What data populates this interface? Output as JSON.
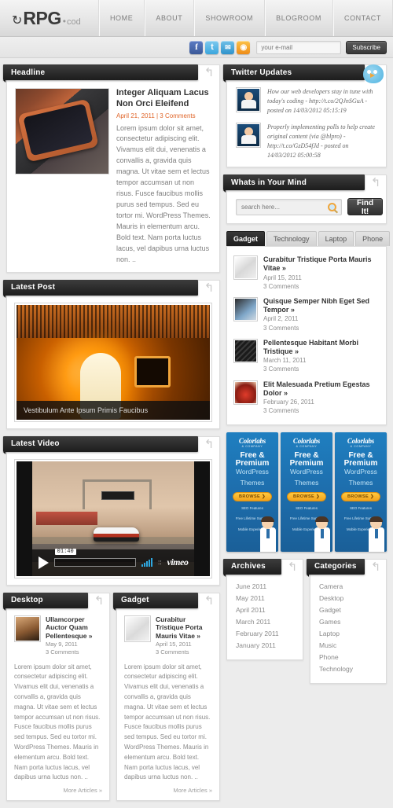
{
  "header": {
    "logo": {
      "arrow_icon": "↻",
      "main": "RPG",
      "dot": "•",
      "sub": "cod"
    },
    "nav": [
      {
        "label": "HOME"
      },
      {
        "label": "ABOUT"
      },
      {
        "label": "SHOWROOM"
      },
      {
        "label": "BLOGROOM"
      },
      {
        "label": "CONTACT"
      }
    ]
  },
  "topbar": {
    "social": [
      {
        "name": "facebook-icon",
        "glyph": "f"
      },
      {
        "name": "twitter-icon",
        "glyph": "t"
      },
      {
        "name": "email-icon",
        "glyph": "✉"
      },
      {
        "name": "rss-icon",
        "glyph": "◉"
      }
    ],
    "email_placeholder": "your e-mail",
    "email_value": "",
    "subscribe_label": "Subscribe"
  },
  "headline": {
    "section_title": "Headline",
    "title": "Integer Aliquam Lacus Non Orci Eleifend",
    "date": "April 21, 2011",
    "comments": "3 Comments",
    "meta": "April 21, 2011 | 3 Comments",
    "body": "Lorem ipsum dolor sit amet, consectetur adipiscing elit. Vivamus elit dui, venenatis a convallis a, gravida quis magna. Ut vitae sem et lectus tempor accumsan ut non risus. Fusce faucibus mollis purus sed tempus. Sed eu tortor mi. WordPress Themes. Mauris in elementum arcu. Bold text. Nam porta luctus lacus, vel dapibus urna luctus non. .."
  },
  "latest_post": {
    "section_title": "Latest Post",
    "caption": "Vestibulum Ante Ipsum Primis Faucibus"
  },
  "latest_video": {
    "section_title": "Latest Video",
    "time": "01:40",
    "provider": "vimeo"
  },
  "twitter": {
    "section_title": "Twitter Updates",
    "items": [
      {
        "text": "How our web developers stay in tune with today's coding - http://t.co/2QJnSGuA - posted on 14/03/2012 05:15:19"
      },
      {
        "text": "Properly implementing polls to help create original content (via @blpro) - http://t.co/GzD54fJd - posted on 14/03/2012 05:00:58"
      }
    ]
  },
  "search": {
    "section_title": "Whats in Your Mind",
    "placeholder": "search here...",
    "value": "",
    "button_label": "Find It!"
  },
  "tabs": {
    "items": [
      {
        "label": "Gadget",
        "active": true
      },
      {
        "label": "Technology",
        "active": false
      },
      {
        "label": "Laptop",
        "active": false
      },
      {
        "label": "Phone",
        "active": false
      }
    ],
    "posts": [
      {
        "title": "Curabitur Tristique Porta Mauris Vitae »",
        "date": "April 15, 2011",
        "comments": "3 Comments"
      },
      {
        "title": "Quisque Semper Nibh Eget Sed Tempor »",
        "date": "April 2, 2011",
        "comments": "3 Comments"
      },
      {
        "title": "Pellentesque Habitant Morbi Tristique »",
        "date": "March 11, 2011",
        "comments": "3 Comments"
      },
      {
        "title": "Elit Malesuada Pretium Egestas Dolor »",
        "date": "February 26, 2011",
        "comments": "3 Comments"
      }
    ]
  },
  "ads": [
    {
      "brand": "Colorlabs",
      "company": "& COMPANY",
      "line1": "Free &",
      "line2": "Premium",
      "line3": "WordPress",
      "line4": "Themes",
      "button": "BROWSE ❯",
      "f1": "SEO Features",
      "f2": "Free Lifetime Support",
      "f3": "Mobile Experience"
    },
    {
      "brand": "Colorlabs",
      "company": "& COMPANY",
      "line1": "Free &",
      "line2": "Premium",
      "line3": "WordPress",
      "line4": "Themes",
      "button": "BROWSE ❯",
      "f1": "SEO Features",
      "f2": "Free Lifetime Support",
      "f3": "Mobile Experience"
    },
    {
      "brand": "Colorlabs",
      "company": "& COMPANY",
      "line1": "Free &",
      "line2": "Premium",
      "line3": "WordPress",
      "line4": "Themes",
      "button": "BROWSE ❯",
      "f1": "SEO Features",
      "f2": "Free Lifetime Support",
      "f3": "Mobile Experience"
    }
  ],
  "desktop_col": {
    "section_title": "Desktop",
    "post_title": "Ullamcorper Auctor Quam Pellentesque »",
    "date": "May 9, 2011",
    "comments": "3 Comments",
    "body": "Lorem ipsum dolor sit amet, consectetur adipiscing elit. Vivamus elit dui, venenatis a convallis a, gravida quis magna. Ut vitae sem et lectus tempor accumsan ut non risus. Fusce faucibus mollis purus sed tempus. Sed eu tortor mi. WordPress Themes. Mauris in elementum arcu. Bold text. Nam porta luctus lacus, vel dapibus urna luctus non. ..",
    "more": "More Articles »"
  },
  "gadget_col": {
    "section_title": "Gadget",
    "post_title": "Curabitur Tristique Porta Mauris Vitae »",
    "date": "April 15, 2011",
    "comments": "3 Comments",
    "body": "Lorem ipsum dolor sit amet, consectetur adipiscing elit. Vivamus elit dui, venenatis a convallis a, gravida quis magna. Ut vitae sem et lectus tempor accumsan ut non risus. Fusce faucibus mollis purus sed tempus. Sed eu tortor mi. WordPress Themes. Mauris in elementum arcu. Bold text. Nam porta luctus lacus, vel dapibus urna luctus non. ..",
    "more": "More Articles »"
  },
  "archives": {
    "section_title": "Archives",
    "items": [
      "June 2011",
      "May 2011",
      "April 2011",
      "March 2011",
      "February 2011",
      "January 2011"
    ]
  },
  "categories": {
    "section_title": "Categories",
    "items": [
      "Camera",
      "Desktop",
      "Gadget",
      "Games",
      "Laptop",
      "Music",
      "Phone",
      "Technology"
    ]
  },
  "icons": {
    "curl": "↰"
  },
  "colors": {
    "accent": "#e0662a",
    "dark": "#1d1d1d",
    "ad_blue": "#1e6fae",
    "ad_yellow": "#f2a31c"
  }
}
